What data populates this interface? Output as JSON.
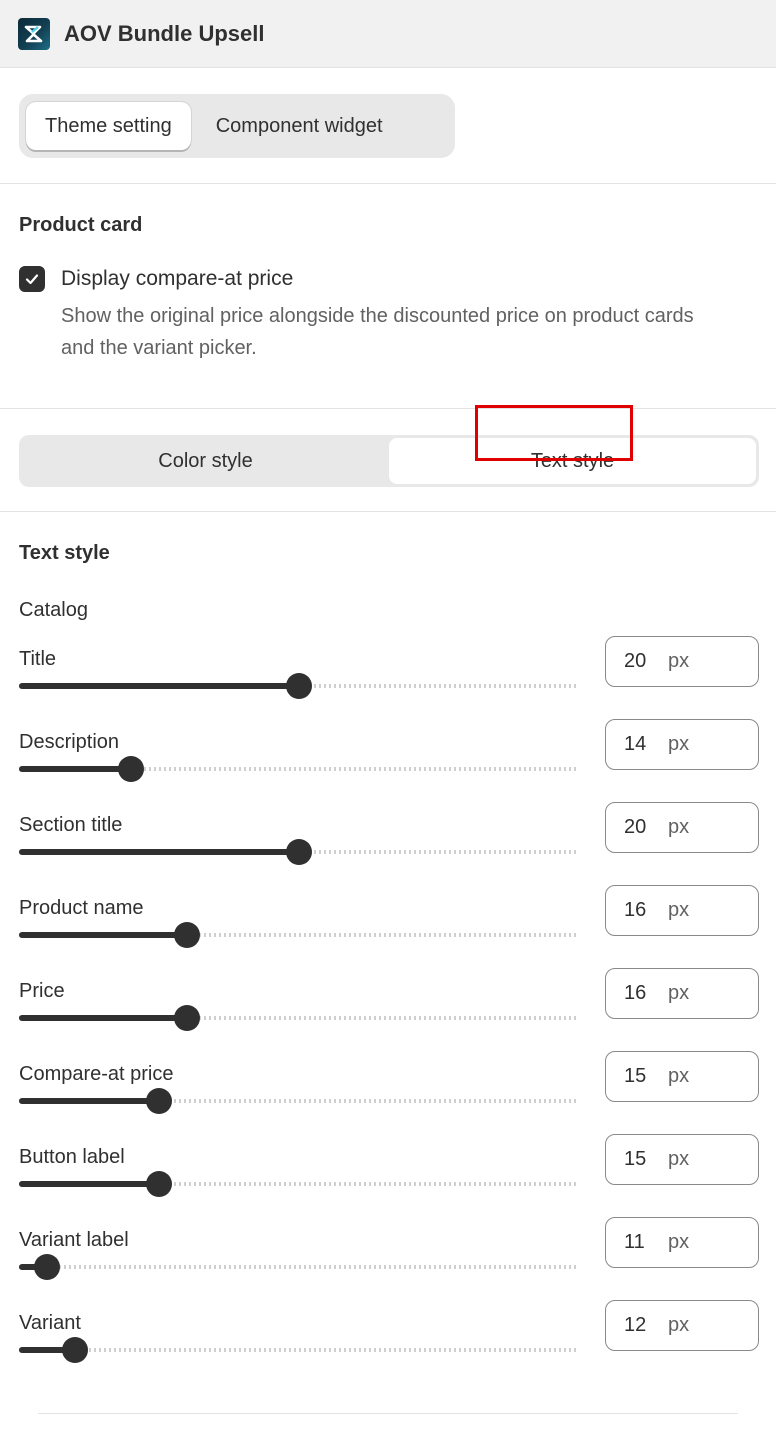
{
  "app": {
    "title": "AOV Bundle Upsell"
  },
  "section_tabs": [
    {
      "label": "Theme setting",
      "active": true
    },
    {
      "label": "Component widget",
      "active": false
    }
  ],
  "product_card": {
    "heading": "Product card",
    "compare_at": {
      "checked": true,
      "label": "Display compare-at price",
      "help": "Show the original price alongside the discounted price on product cards and the variant picker."
    }
  },
  "style_tabs": [
    {
      "label": "Color style",
      "active": false
    },
    {
      "label": "Text style",
      "active": true
    }
  ],
  "text_style": {
    "heading": "Text style",
    "group": "Catalog",
    "unit": "px",
    "slider_min": 10,
    "slider_max": 30,
    "rows": [
      {
        "label": "Title",
        "value": 20
      },
      {
        "label": "Description",
        "value": 14
      },
      {
        "label": "Section title",
        "value": 20
      },
      {
        "label": "Product name",
        "value": 16
      },
      {
        "label": "Price",
        "value": 16
      },
      {
        "label": "Compare-at price",
        "value": 15
      },
      {
        "label": "Button label",
        "value": 15
      },
      {
        "label": "Variant label",
        "value": 11
      },
      {
        "label": "Variant",
        "value": 12
      }
    ]
  },
  "colors": {
    "primary": "#303030",
    "highlight": "#e00000",
    "topbar": "#f1f1f1"
  }
}
